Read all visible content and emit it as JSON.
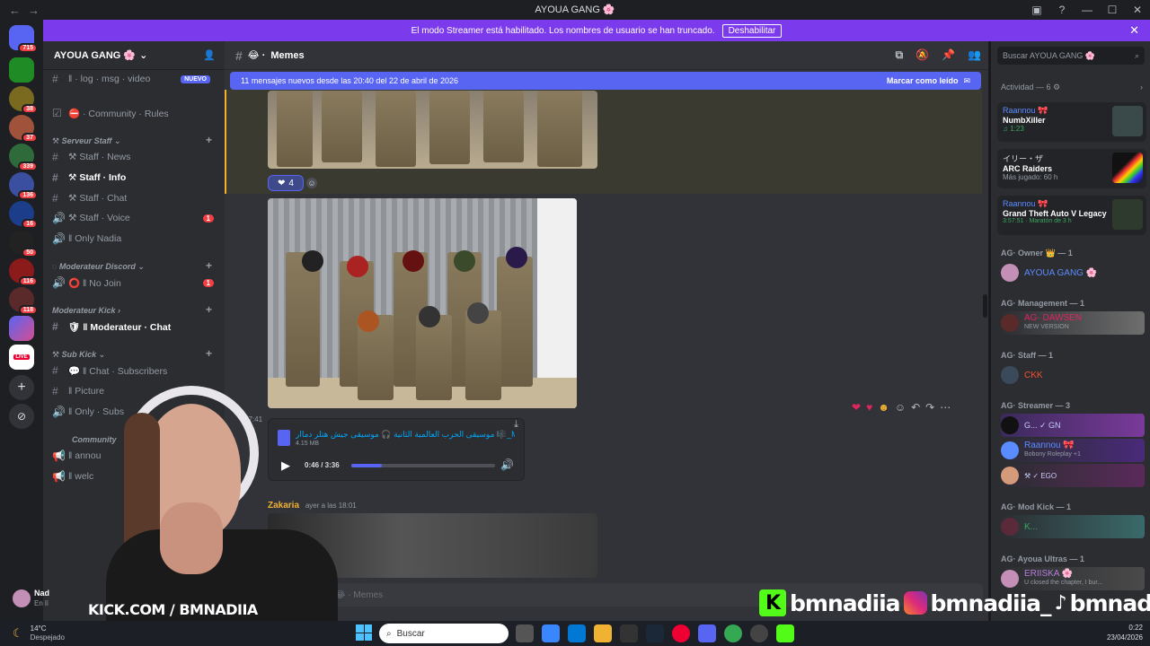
{
  "window": {
    "title": "AYOUA GANG 🌸",
    "nav_back": "←",
    "nav_fwd": "→"
  },
  "banner": {
    "text": "El modo Streamer está habilitado. Los nombres de usuario se han truncado.",
    "button": "Deshabilitar",
    "close": "✕"
  },
  "rail": {
    "badges": [
      "715",
      "38",
      "37",
      "339",
      "136",
      "16",
      "50",
      "116",
      "118"
    ],
    "live_label": "LIVE"
  },
  "server": {
    "name": "AYOUA GANG 🌸",
    "channels_top": [
      {
        "label": "‖ · log · msg · video",
        "tag": "NUEVO"
      },
      {
        "label": "⛔ · Community · Rules"
      }
    ],
    "categories": {
      "staff": "⚒ Serveur Staff",
      "mod_discord": "Moderateur Discord",
      "mod_kick": "Moderateur Kick",
      "sub_kick": "Sub Kick",
      "community": "Community"
    },
    "staff_channels": [
      {
        "label": "⚒ Staff · News"
      },
      {
        "label": "⚒ Staff · Info"
      },
      {
        "label": "⚒ Staff · Chat"
      },
      {
        "label": "⚒ Staff · Voice",
        "badge": "1"
      },
      {
        "label": "‖ Only Nadia"
      }
    ],
    "mod_discord_channels": [
      {
        "label": "⭕ ‖ No Join",
        "badge": "1"
      }
    ],
    "mod_kick_channels": [
      {
        "label": "🛡 ‖ Moderateur · Chat"
      }
    ],
    "sub_kick_channels": [
      {
        "label": "💬 ‖ Chat · Subscribers"
      },
      {
        "label": "‖ Picture"
      },
      {
        "label": "‖ Only · Subs"
      }
    ],
    "community_channels": [
      {
        "label": "‖ annou"
      },
      {
        "label": "‖ welc"
      }
    ],
    "user_name": "Nad",
    "user_status": "En lí"
  },
  "chat": {
    "channel": "Memes",
    "new_messages": "11 mensajes nuevos desde las 20:40 del 22 de abril de 2026",
    "mark_read": "Marcar como leído",
    "reaction_count": "4",
    "audio_time_stamp": "17:41",
    "audio_title": "موسيقى الحرب العالمية الثانية 🎧 موسيقى جيش هتلر دماار 🎼_MP3)",
    "audio_size": "4.15 MB",
    "audio_progress_label": "0:46 / 3:36",
    "audio_progress": 0.213,
    "next_author": "Zakaria",
    "next_time": "ayer a las 18:01",
    "composer_placeholder": "aje a # 😂 · Memes"
  },
  "members": {
    "search_placeholder": "Buscar AYOUA GANG 🌸",
    "activity_header": "Actividad — 6 ⚙",
    "activities": [
      {
        "user": "Raannou 🎀",
        "title": "NumbXiller",
        "sub": "♫ 1:23"
      },
      {
        "user": "イリー・ザ",
        "title": "ARC Raiders",
        "sub": "Más jugado: 60 h"
      },
      {
        "user": "Raannou 🎀",
        "title": "Grand Theft Auto V Legacy",
        "sub": "3:57:51 · Maratón de 3 h"
      }
    ],
    "groups": [
      {
        "label": "AG· Owner 👑 — 1",
        "members": [
          {
            "name": "AYOUA GANG 🌸",
            "color": "#5b8cff"
          }
        ]
      },
      {
        "label": "AG· Management — 1",
        "members": [
          {
            "name": "AG· DAWSEN",
            "sub": "NEW VERSION",
            "color": "#e0245e"
          }
        ]
      },
      {
        "label": "AG· Staff — 1",
        "members": [
          {
            "name": "CKK",
            "color": "#f0502f"
          }
        ]
      },
      {
        "label": "AG· Streamer — 3",
        "members": [
          {
            "name": "G... ✓ GN",
            "color": "#c9cdfb"
          },
          {
            "name": "Raannou 🎀",
            "sub": "Bobony Roleplay +1",
            "color": "#5b8cff"
          },
          {
            "name": "⚒ ✓ EGO",
            "color": "#c9cdfb"
          }
        ]
      },
      {
        "label": "AG· Mod Kick — 1",
        "members": [
          {
            "name": "K...",
            "color": "#3ba55d"
          }
        ]
      },
      {
        "label": "AG· Ayoua Ultras — 1",
        "members": [
          {
            "name": "ERIISKA 🌸",
            "sub": "U closed the chapter, I bur...",
            "color": "#b57edc"
          }
        ]
      }
    ]
  },
  "taskbar": {
    "weather_temp": "14°C",
    "weather_desc": "Despejado",
    "search_placeholder": "Buscar",
    "time": "0:22",
    "date": "23/04/2026"
  },
  "overlay": {
    "kick_text": "KICK.COM / BMNADIIA",
    "handle1": "bmnadiia",
    "handle2": "bmnadiia_",
    "handle3": "bmnadiia"
  },
  "colors": {
    "accent": "#5865f2",
    "banner": "#7c3aed",
    "kick_green": "#53fc18"
  }
}
